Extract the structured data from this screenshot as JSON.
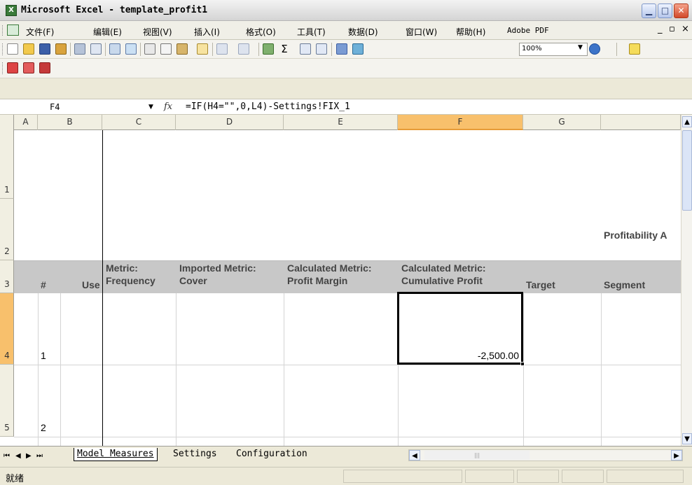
{
  "window": {
    "title": "Microsoft Excel - template_profit1",
    "app_icon": "excel-icon",
    "controls": [
      "minimize-icon",
      "maximize-icon",
      "close-icon"
    ]
  },
  "menu": {
    "items": [
      "文件(F)",
      "编辑(E)",
      "视图(V)",
      "插入(I)",
      "格式(O)",
      "工具(T)",
      "数据(D)",
      "窗口(W)",
      "帮助(H)",
      "Adobe PDF"
    ],
    "doc_controls": [
      "_",
      "▫",
      "×"
    ]
  },
  "toolbar": {
    "zoom": "100%",
    "icons": [
      "new-icon",
      "open-icon",
      "save-icon",
      "permission-icon",
      "print-icon",
      "print-preview-icon",
      "spelling-icon",
      "research-icon",
      "cut-icon",
      "copy-icon",
      "paste-icon",
      "format-painter-icon",
      "undo-icon",
      "redo-icon",
      "hyperlink-icon",
      "autosum-icon",
      "sort-ascending-icon",
      "sort-descending-icon",
      "chart-wizard-icon",
      "drawing-icon",
      "help-icon",
      "fill-color-icon"
    ]
  },
  "pdf_toolbar": {
    "icons": [
      "pdf-convert-icon",
      "pdf-email-icon",
      "pdf-review-icon"
    ]
  },
  "formula_bar": {
    "cell_ref": "F4",
    "fx_label": "fx",
    "formula": "=IF(H4=\"\",0,L4)-Settings!FIX_1"
  },
  "grid": {
    "column_headers": [
      "A",
      "B",
      "C",
      "D",
      "E",
      "F",
      "G"
    ],
    "active_column": "F",
    "row_headers": [
      "1",
      "2",
      "3",
      "4",
      "5"
    ],
    "active_row": "4",
    "title_cell": "Profitability A",
    "header_row": {
      "a": "#",
      "b": "Use",
      "c": "Metric:\nFrequency",
      "d": "Imported Metric:\nCover",
      "e": "Calculated Metric:\nProfit Margin",
      "f": "Calculated Metric:\nCumulative Profit",
      "g": "Target",
      "h": "Segment"
    },
    "rows": [
      {
        "num": "1",
        "f_value": "-2,500.00"
      },
      {
        "num": "2",
        "f_value": ""
      }
    ]
  },
  "sheets": {
    "tabs": [
      "Model Measures",
      "Settings",
      "Configuration"
    ],
    "active": "Model Measures"
  },
  "status": {
    "text": "就绪"
  }
}
